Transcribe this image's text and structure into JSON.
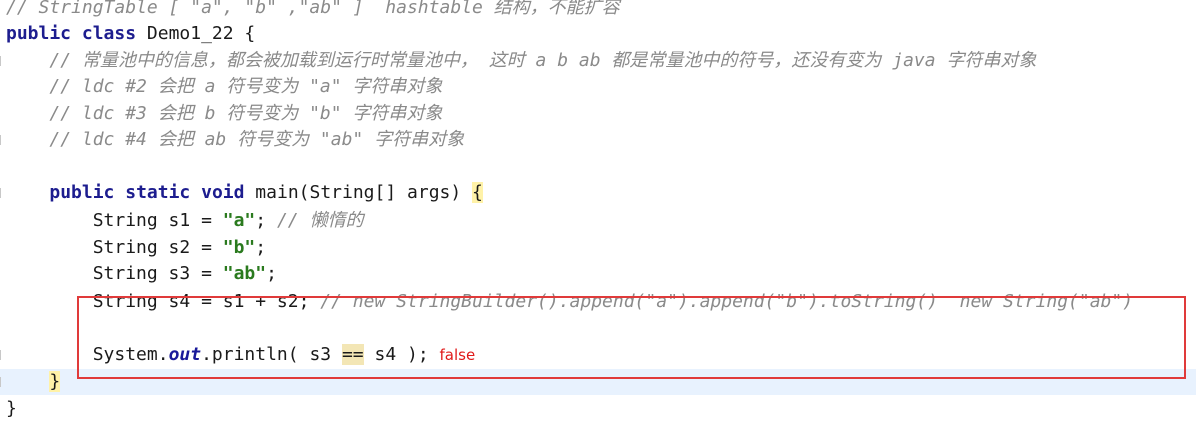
{
  "editor": {
    "lines": [
      {
        "indent": "",
        "parts": [
          {
            "t": "cmt",
            "v": "// StringTable [ \"a\", \"b\" ,\"ab\" ]  hashtable 结构，不能扩容"
          }
        ]
      },
      {
        "indent": "",
        "parts": [
          {
            "t": "kw",
            "v": "public"
          },
          {
            "t": "txt",
            "v": " "
          },
          {
            "t": "kw",
            "v": "class"
          },
          {
            "t": "txt",
            "v": " Demo1_22 {"
          }
        ]
      },
      {
        "indent": "    ",
        "parts": [
          {
            "t": "cmt",
            "v": "// 常量池中的信息，都会被加载到运行时常量池中， 这时 a b ab 都是常量池中的符号，还没有变为 java 字符串对象"
          }
        ]
      },
      {
        "indent": "    ",
        "parts": [
          {
            "t": "cmt",
            "v": "// ldc #2 会把 a 符号变为 \"a\" 字符串对象"
          }
        ]
      },
      {
        "indent": "    ",
        "parts": [
          {
            "t": "cmt",
            "v": "// ldc #3 会把 b 符号变为 \"b\" 字符串对象"
          }
        ]
      },
      {
        "indent": "    ",
        "parts": [
          {
            "t": "cmt",
            "v": "// ldc #4 会把 ab 符号变为 \"ab\" 字符串对象"
          }
        ]
      },
      {
        "indent": "",
        "parts": []
      },
      {
        "indent": "    ",
        "parts": [
          {
            "t": "kw",
            "v": "public"
          },
          {
            "t": "txt",
            "v": " "
          },
          {
            "t": "kw",
            "v": "static"
          },
          {
            "t": "txt",
            "v": " "
          },
          {
            "t": "kw",
            "v": "void"
          },
          {
            "t": "txt",
            "v": " main(String[] args) "
          },
          {
            "t": "brace",
            "v": "{"
          }
        ]
      },
      {
        "indent": "        ",
        "parts": [
          {
            "t": "txt",
            "v": "String s1 = "
          },
          {
            "t": "str",
            "v": "\"a\""
          },
          {
            "t": "txt",
            "v": "; "
          },
          {
            "t": "cmt",
            "v": "// 懒惰的"
          }
        ]
      },
      {
        "indent": "        ",
        "parts": [
          {
            "t": "txt",
            "v": "String s2 = "
          },
          {
            "t": "str",
            "v": "\"b\""
          },
          {
            "t": "txt",
            "v": ";"
          }
        ]
      },
      {
        "indent": "        ",
        "parts": [
          {
            "t": "txt",
            "v": "String s3 = "
          },
          {
            "t": "str",
            "v": "\"ab\""
          },
          {
            "t": "txt",
            "v": ";"
          }
        ]
      },
      {
        "indent": "        ",
        "parts": [
          {
            "t": "txt",
            "v": "String s4 = s1 + s2; "
          },
          {
            "t": "cmt",
            "v": "// new StringBuilder().append(\"a\").append(\"b\").toString()  new String(\"ab\")"
          }
        ]
      },
      {
        "indent": "",
        "parts": []
      },
      {
        "indent": "        ",
        "parts": [
          {
            "t": "txt",
            "v": "System."
          },
          {
            "t": "field",
            "v": "out"
          },
          {
            "t": "txt",
            "v": ".println( s3 "
          },
          {
            "t": "op",
            "v": "=="
          },
          {
            "t": "txt",
            "v": " s4 ); "
          },
          {
            "t": "annot",
            "v": "false"
          }
        ]
      },
      {
        "indent": "    ",
        "parts": [
          {
            "t": "brace",
            "v": "}"
          }
        ]
      },
      {
        "indent": "",
        "parts": [
          {
            "t": "txt",
            "v": "}"
          }
        ]
      }
    ]
  }
}
